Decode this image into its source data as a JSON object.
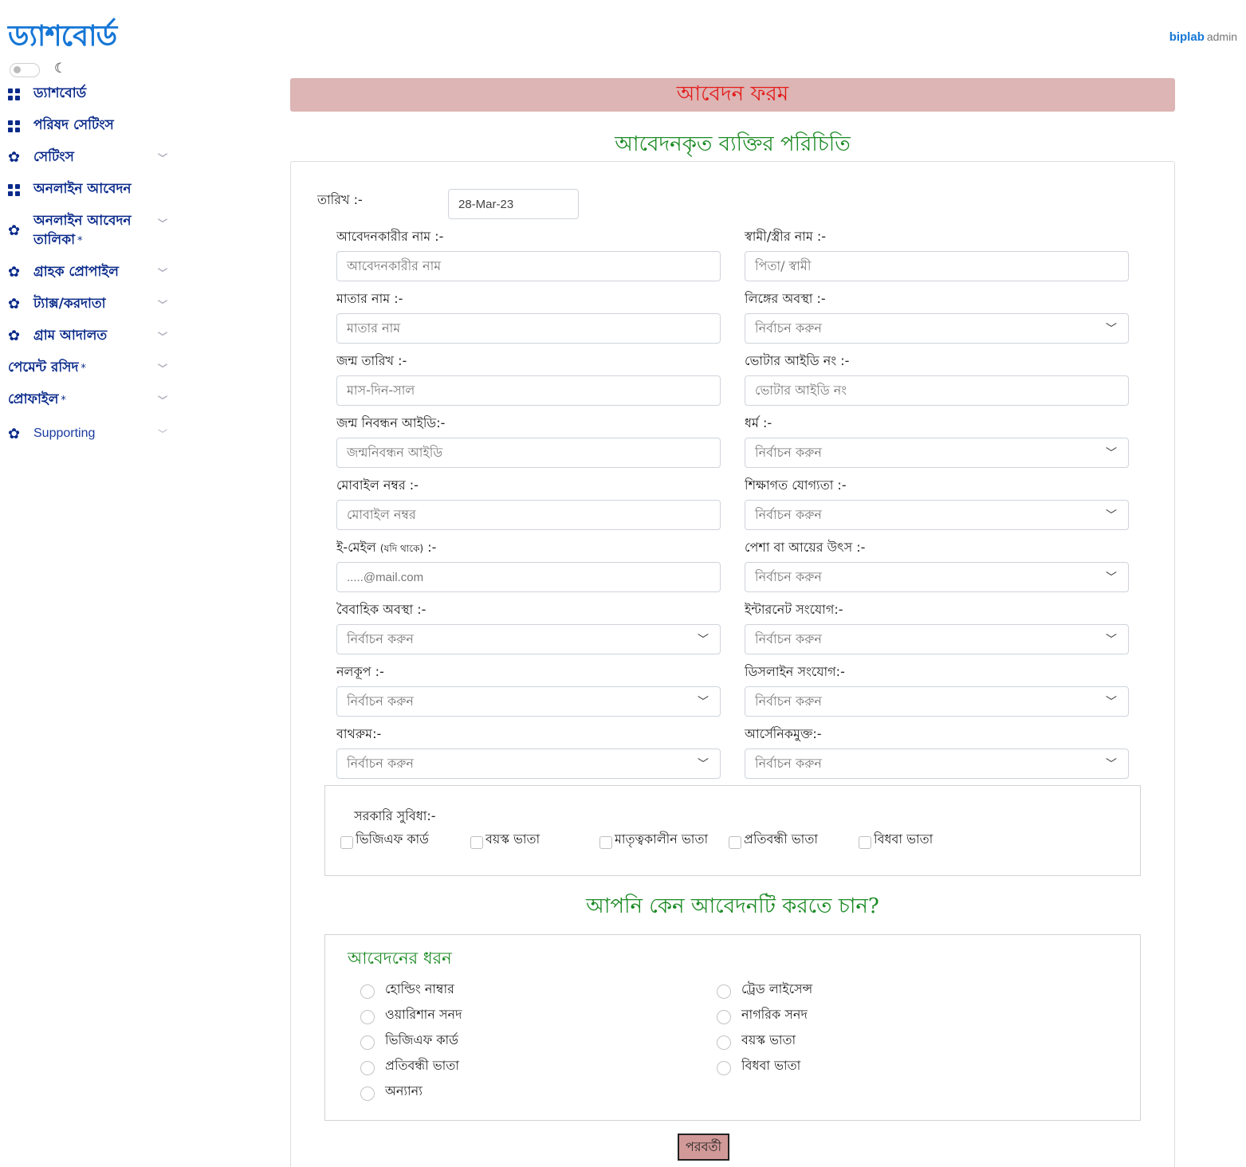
{
  "brand": "ড্যাশবোর্ড",
  "user": {
    "name": "biplab",
    "role": "admin"
  },
  "sidebar": {
    "items": [
      {
        "label": "ড্যাশবোর্ড",
        "icon": "grid-icon"
      },
      {
        "label": "পরিষদ সেটিংস",
        "icon": "grid-icon"
      },
      {
        "label": "সেটিংস",
        "icon": "gear-icon"
      },
      {
        "label": "অনলাইন আবেদন",
        "icon": "grid-icon"
      },
      {
        "label_line1": "অনলাইন আবেদন",
        "label_line2": "তালিকা",
        "star": "*",
        "icon": "gear-icon"
      },
      {
        "label": "গ্রাহক প্রোপাইল",
        "icon": "gear-icon"
      },
      {
        "label": "ট্যাক্স/করদাতা",
        "icon": "gear-icon"
      },
      {
        "label": "গ্রাম আদালত",
        "icon": "gear-icon"
      },
      {
        "label": "পেমেন্ট রসিদ",
        "star": "*"
      },
      {
        "label": "প্রোফাইল",
        "star": "*"
      },
      {
        "label": "Supporting",
        "icon": "gear-icon"
      }
    ]
  },
  "form": {
    "banner": "আবেদন ফরম",
    "section_title": "আবেদনকৃত ব্যক্তির পরিচিতি",
    "date_label": "তারিখ :-",
    "date_value": "28-Mar-23",
    "select_placeholder": "নির্বাচন করুন",
    "fields": {
      "applicant_name_label": "আবেদনকারীর নাম :-",
      "applicant_name_ph": "আবেদনকারীর নাম",
      "spouse_label": "স্বামী/স্ত্রীর নাম :-",
      "spouse_ph": "পিতা/ স্বামী",
      "mother_label": "মাতার নাম :-",
      "mother_ph": "মাতার নাম",
      "gender_label": "লিঙ্গের অবস্থা :-",
      "dob_label": "জন্ম তারিখ :-",
      "dob_ph": "মাস-দিন-সাল",
      "voter_label": "ভোটার আইডি নং :-",
      "voter_ph": "ভোটার আইডি নং",
      "birthreg_label": "জন্ম নিবন্ধন আইডি:-",
      "birthreg_ph": "জন্মনিবন্ধন আইডি",
      "religion_label": "ধর্ম :-",
      "mobile_label": "মোবাইল নম্বর :-",
      "mobile_ph": "মোবাইল নম্বর",
      "education_label": "শিক্ষাগত যোগ্যতা :-",
      "email_label": "ই-মেইল",
      "email_label_small": "(যদি থাকে)",
      "email_label_suffix": ":-",
      "email_ph": ".....@mail.com",
      "occupation_label": "পেশা বা আয়ের উৎস :-",
      "marital_label": "বৈবাহিক অবস্থা :-",
      "internet_label": "ইন্টারনেট সংযোগ:-",
      "tubewell_label": "নলকূপ :-",
      "dishline_label": "ডিসলাইন সংযোগ:-",
      "bathroom_label": "বাথরুম:-",
      "arsenic_label": "আর্সেনিকমুক্ত:-"
    },
    "benefits": {
      "title": "সরকারি সুবিধা:-",
      "options": [
        "ভিজিএফ কার্ড",
        "বয়স্ক ভাতা",
        "মাতৃত্বকালীন ভাতা",
        "প্রতিবন্ধী ভাতা",
        "বিধবা ভাতা"
      ]
    },
    "why_title": "আপনি কেন আবেদনটি করতে চান?",
    "application_type": {
      "title": "আবেদনের ধরন",
      "left": [
        "হোল্ডিং নাম্বার",
        "ওয়ারিশান সনদ",
        "ভিজিএফ কার্ড",
        "প্রতিবন্ধী ভাতা",
        "অন্যান্য"
      ],
      "right": [
        "ট্রেড লাইসেন্স",
        "নাগরিক সনদ",
        "বয়স্ক ভাতা",
        "বিধবা ভাতা"
      ]
    },
    "next_label": "পরবর্তী"
  },
  "colors": {
    "brand": "#1677d6",
    "nav": "#0a2a8a",
    "banner_bg": "#dcb5b4",
    "banner_text": "#e31b1b",
    "section_title": "#1b8a23",
    "button": "#d19a98"
  }
}
